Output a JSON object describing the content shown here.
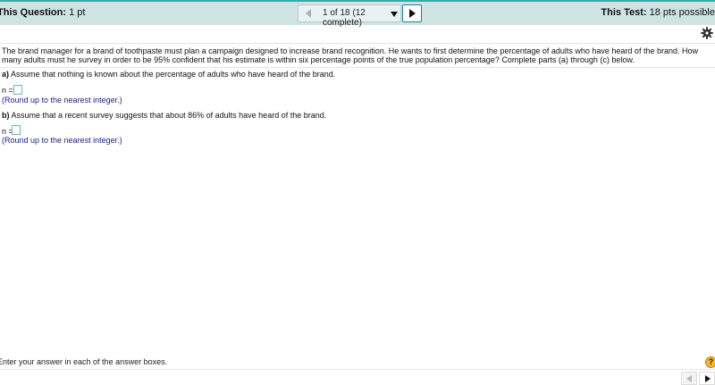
{
  "header": {
    "question_label": "This Question:",
    "question_points": "1 pt",
    "progress_select": "1 of 18 (12 complete)",
    "test_label": "This Test:",
    "test_points": "18 pts possible"
  },
  "problem": {
    "text": "The brand manager for a brand of toothpaste must plan a campaign designed to increase brand recognition. He wants to first determine the percentage of adults who have heard of the brand. How many adults must he survey in order to be 95% confident that his estimate is within six percentage points of the true population percentage? Complete parts (a) through (c) below."
  },
  "parts": [
    {
      "letter": "a)",
      "text": "Assume that nothing is known about the percentage of adults who have heard of the brand.",
      "answer_label": "n =",
      "answer_value": "",
      "hint": "(Round up to the nearest integer.)"
    },
    {
      "letter": "b)",
      "text": "Assume that a recent survey suggests that about 86% of adults have heard of the brand.",
      "answer_label": "n =",
      "answer_value": "",
      "hint": "(Round up to the nearest integer.)"
    }
  ],
  "footer": {
    "instruction": "Enter your answer in each of the answer boxes.",
    "help_symbol": "?"
  },
  "icons": {
    "settings": "gear-icon",
    "prev": "triangle-left-icon",
    "next": "triangle-right-icon",
    "dropdown": "triangle-down-icon",
    "help": "help-icon"
  },
  "colors": {
    "header_bg": "#cfe3e3",
    "header_accent": "#2eaeb0",
    "hint_text": "#1a1a8c",
    "answer_border": "#6ab7c6",
    "help_bg": "#f2b92a"
  }
}
